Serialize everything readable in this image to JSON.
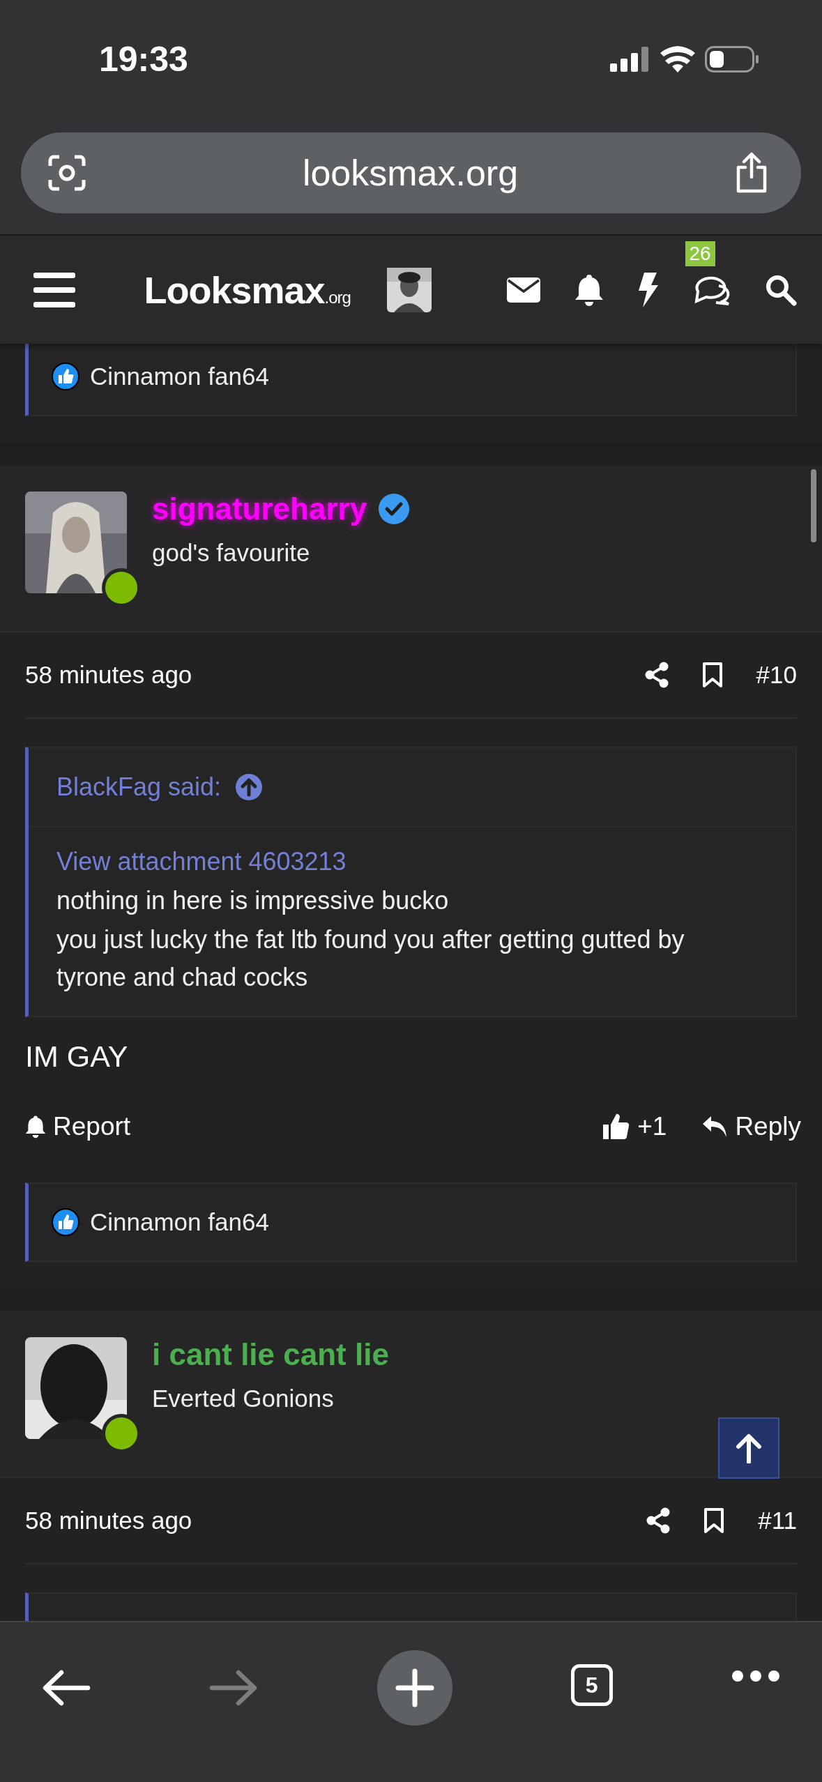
{
  "status_bar": {
    "time": "19:33"
  },
  "browser": {
    "url": "looksmax.org",
    "tab_count": "5",
    "forward_enabled": false
  },
  "nav": {
    "logo": "Looksmax",
    "logo_suffix": ".org",
    "conversations_badge": "26"
  },
  "top_reactions": {
    "names": "Cinnamon fan64"
  },
  "posts": [
    {
      "username": "signatureharry",
      "color": "#ff00ff",
      "name_glow": true,
      "verified": true,
      "online": true,
      "title": "god's favourite",
      "time": "58 minutes ago",
      "number": "#10",
      "quote": {
        "author": "BlackFag said:",
        "link": "View attachment 4603213",
        "lines": [
          "nothing in here is impressive bucko",
          "you just lucky the fat ltb found you after getting gutted by tyrone and chad cocks"
        ]
      },
      "body": "IM GAY",
      "actions": {
        "report": "Report",
        "likes": "+1",
        "reply": "Reply"
      },
      "reactions": "Cinnamon fan64"
    },
    {
      "username": "i cant lie cant lie",
      "color": "#4caf50",
      "name_glow": false,
      "verified": false,
      "online": true,
      "title": "Everted Gonions",
      "time": "58 minutes ago",
      "number": "#11",
      "quote_cut": true
    }
  ]
}
